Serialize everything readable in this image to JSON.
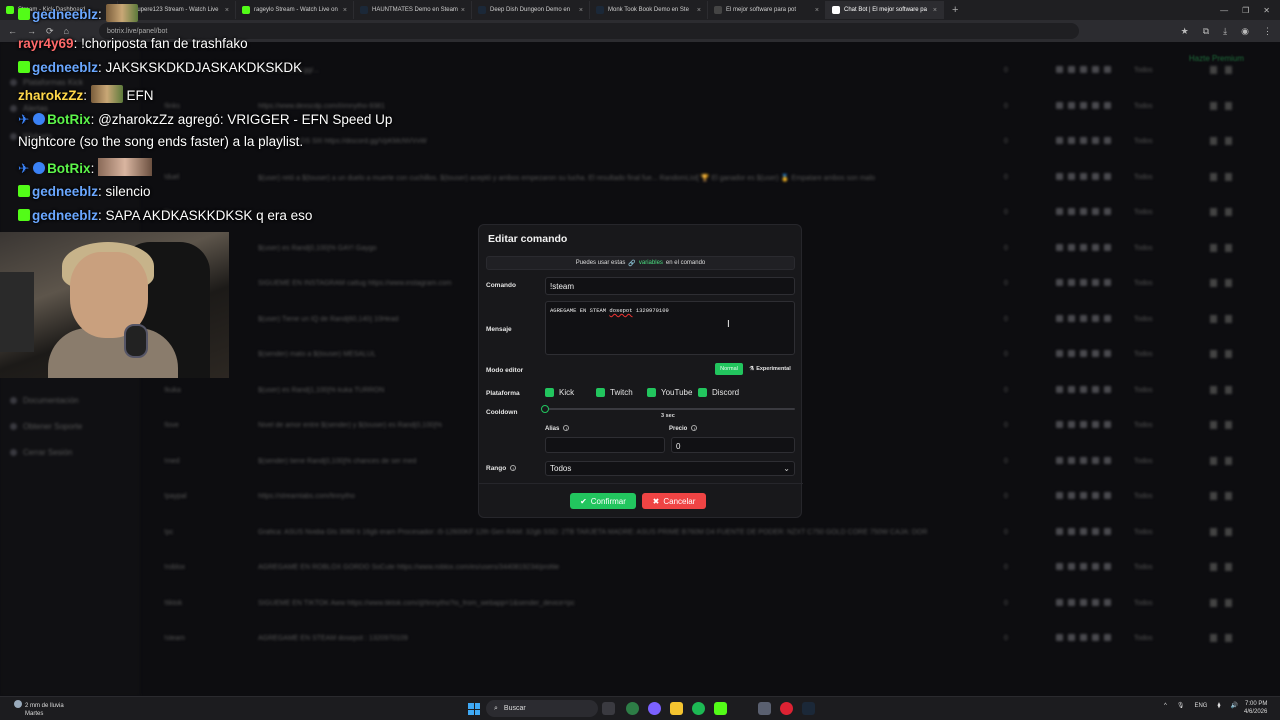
{
  "browser": {
    "tabs": [
      {
        "label": "Stream - Kick Dashboard",
        "fav": "#53fc18"
      },
      {
        "label": "lupere123 Stream - Watch Live",
        "fav": "#53fc18"
      },
      {
        "label": "rageylo Stream - Watch Live on",
        "fav": "#53fc18"
      },
      {
        "label": "HAUNTMATES Demo en Steam",
        "fav": "#1b2838"
      },
      {
        "label": "Deep Dish Dungeon Demo en",
        "fav": "#1b2838"
      },
      {
        "label": "Monk Took Book Demo en Ste",
        "fav": "#1b2838"
      },
      {
        "label": "El mejor software para pot",
        "fav": "#444"
      },
      {
        "label": "Chat Bot | El mejor software pa",
        "fav": "#ffffff",
        "active": true
      }
    ],
    "url": "botrix.live/panel/bot"
  },
  "sidebar": {
    "items": [
      "Alertas",
      "Widgets",
      "Plataformas Kick",
      "Documentación",
      "Obtener Soporte",
      "Cerrar Sesión"
    ]
  },
  "premium": "Hazte Premium",
  "table": {
    "rows": [
      {
        "cmd": "!discord",
        "text": "https://discord.gg/...",
        "cd": "0",
        "rank": "Todos"
      },
      {
        "cmd": "!links",
        "text": "https://www.dexscdp.com/l/imnytho-9381",
        "cd": "0",
        "rank": "Todos"
      },
      {
        "cmd": "!ds",
        "text": "SERVER DE DS SIII https://discord.gg/VpKMcNVVvW",
        "cd": "0",
        "rank": "Todos"
      },
      {
        "cmd": "!duel",
        "text": "$(user) retó a $(touser) a un duelo a muerte con cuchillos. $(touser) aceptó y ambos empezaron su lucha. El resultado final fue... RandomList[ 🏆 El ganador es $(user) 🥇 Empatare ambos son malo",
        "cd": "0",
        "rank": "Todos"
      },
      {
        "cmd": "!ig",
        "text": "",
        "cd": "0",
        "rank": "Todos"
      },
      {
        "cmd": "!gay",
        "text": "$(user) es Rand[0,100]% GAY! Gaygo",
        "cd": "0",
        "rank": "Todos"
      },
      {
        "cmd": "!insta",
        "text": "SIGUEME EN INSTAGRAM cattug https://www.instagram.com",
        "cd": "0",
        "rank": "Todos"
      },
      {
        "cmd": "!iq",
        "text": "$(user) Tiene un IQ de Rand[60,140] 10Head",
        "cd": "0",
        "rank": "Todos"
      },
      {
        "cmd": "!mata",
        "text": "$(sender) mato a $(touser) MESALUL",
        "cd": "0",
        "rank": "Todos"
      },
      {
        "cmd": "!kuka",
        "text": "$(user) es Rand[1,100]% kuka TURRON",
        "cd": "0",
        "rank": "Todos"
      },
      {
        "cmd": "!love",
        "text": "Nivel de amor entre $(sender) y $(touser) es Rand[0,100]%",
        "cd": "0",
        "rank": "Todos"
      },
      {
        "cmd": "!med",
        "text": "$(sender) tiene Rand[0,100]% chances de ser med",
        "cd": "0",
        "rank": "Todos"
      },
      {
        "cmd": "!paypal",
        "text": "https://streamlabs.com/finnytho",
        "cd": "0",
        "rank": "Todos"
      },
      {
        "cmd": "!pc",
        "text": "Grafica: ASUS Nvidia Gts 3060 ti 16gb eram Procesador: i5-12600KF 12th Gen RAM: 32gb SSD: 2TB TARJETA MADRE: ASUS PRIME B760M D4 FUENTE DE PODER: NZXT C750 GOLD CORE 750W CAJA: DOR",
        "cd": "0",
        "rank": "Todos"
      },
      {
        "cmd": "!roblox",
        "text": "AGREGAME EN ROBLOX GORDO SoCute https://www.roblox.com/es/users/3440819234/profile",
        "cd": "0",
        "rank": "Todos"
      },
      {
        "cmd": "!tiktok",
        "text": "SIGUEME EN TIKTOK Aww https://www.tiktok.com/@finnytho?is_from_webapp=1&sender_device=pc",
        "cd": "0",
        "rank": "Todos"
      },
      {
        "cmd": "!steam",
        "text": "AGREGAME EN STEAM dosepot : 1320970109",
        "cd": "0",
        "rank": "Todos"
      }
    ]
  },
  "chat": {
    "lines": [
      {
        "user": "gedneeblz",
        "color": "u-blue",
        "msg": "",
        "emote": true,
        "kick": true
      },
      {
        "user": "rayr4y69",
        "color": "u-red",
        "msg": "!choriposta fan de trashfako",
        "kick": false
      },
      {
        "user": "gedneeblz",
        "color": "u-blue",
        "msg": "JAKSKSKDKDJASKAKDKSKDK",
        "kick": true
      },
      {
        "user": "zharokzZz",
        "color": "u-yellow",
        "msg": "EFN",
        "emote": true,
        "kick": false
      },
      {
        "user": "BotRix",
        "color": "u-green",
        "msg": "@zharokzZz agregó: VRIGGER - EFN Speed Up",
        "bot": true
      },
      {
        "user": "",
        "color": "",
        "msg": "Nightcore (so the song ends faster) a la playlist."
      },
      {
        "user": "BotRix",
        "color": "u-green",
        "msg": "",
        "bot": true,
        "img": true
      },
      {
        "user": "gedneeblz",
        "color": "u-blue",
        "msg": "silencio",
        "kick": true
      },
      {
        "user": "gedneeblz",
        "color": "u-blue",
        "msg": "SAPA AKDKASKKDKSK q era eso",
        "kick": true
      }
    ]
  },
  "modal": {
    "title": "Editar comando",
    "vars_prefix": "Puedes usar estas",
    "vars_link": "variables",
    "vars_suffix": "en el comando",
    "comando_label": "Comando",
    "comando_value": "!steam",
    "mensaje_label": "Mensaje",
    "mensaje_pre": "AGREGAME EN STEAM ",
    "mensaje_sq": "dosepot",
    "mensaje_post": " 1320970109",
    "modo_label": "Modo editor",
    "modo_normal": "Normal",
    "modo_exp": "Experimental",
    "plataforma_label": "Plataforma",
    "platforms": [
      "Kick",
      "Twitch",
      "YouTube",
      "Discord"
    ],
    "cooldown_label": "Cooldown",
    "cooldown_value": "3 sec",
    "cooldown_fraction": 0,
    "alias_label": "Alias",
    "alias_value": "",
    "precio_label": "Precio",
    "precio_value": "0",
    "rango_label": "Rango",
    "rango_value": "Todos",
    "confirm": "Confirmar",
    "cancel": "Cancelar"
  },
  "taskbar": {
    "weather_line1": "2 mm de lluvia",
    "weather_line2": "Martes",
    "search": "Buscar",
    "lang": "ENG",
    "time": "7:00 PM",
    "date": "4/6/2026"
  },
  "colors": {
    "accent": "#22c55e",
    "danger": "#ef4444",
    "kick": "#53fc18"
  }
}
